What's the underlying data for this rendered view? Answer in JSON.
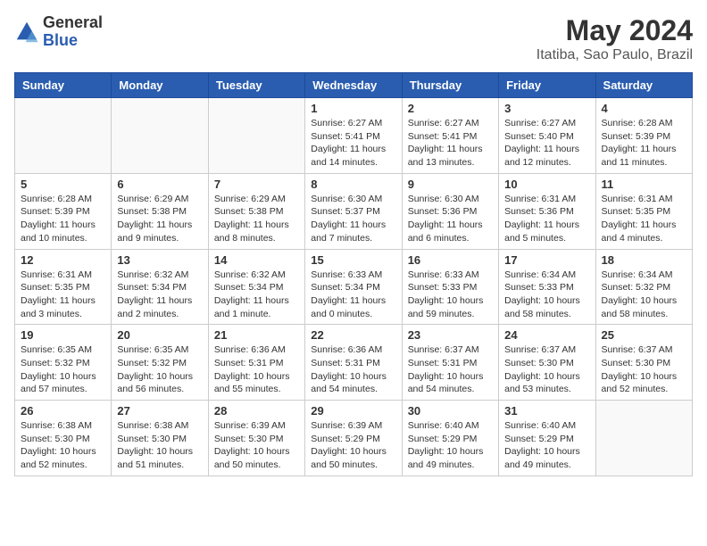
{
  "logo": {
    "general": "General",
    "blue": "Blue"
  },
  "title": "May 2024",
  "subtitle": "Itatiba, Sao Paulo, Brazil",
  "weekdays": [
    "Sunday",
    "Monday",
    "Tuesday",
    "Wednesday",
    "Thursday",
    "Friday",
    "Saturday"
  ],
  "weeks": [
    [
      {
        "day": "",
        "info": ""
      },
      {
        "day": "",
        "info": ""
      },
      {
        "day": "",
        "info": ""
      },
      {
        "day": "1",
        "info": "Sunrise: 6:27 AM\nSunset: 5:41 PM\nDaylight: 11 hours and 14 minutes."
      },
      {
        "day": "2",
        "info": "Sunrise: 6:27 AM\nSunset: 5:41 PM\nDaylight: 11 hours and 13 minutes."
      },
      {
        "day": "3",
        "info": "Sunrise: 6:27 AM\nSunset: 5:40 PM\nDaylight: 11 hours and 12 minutes."
      },
      {
        "day": "4",
        "info": "Sunrise: 6:28 AM\nSunset: 5:39 PM\nDaylight: 11 hours and 11 minutes."
      }
    ],
    [
      {
        "day": "5",
        "info": "Sunrise: 6:28 AM\nSunset: 5:39 PM\nDaylight: 11 hours and 10 minutes."
      },
      {
        "day": "6",
        "info": "Sunrise: 6:29 AM\nSunset: 5:38 PM\nDaylight: 11 hours and 9 minutes."
      },
      {
        "day": "7",
        "info": "Sunrise: 6:29 AM\nSunset: 5:38 PM\nDaylight: 11 hours and 8 minutes."
      },
      {
        "day": "8",
        "info": "Sunrise: 6:30 AM\nSunset: 5:37 PM\nDaylight: 11 hours and 7 minutes."
      },
      {
        "day": "9",
        "info": "Sunrise: 6:30 AM\nSunset: 5:36 PM\nDaylight: 11 hours and 6 minutes."
      },
      {
        "day": "10",
        "info": "Sunrise: 6:31 AM\nSunset: 5:36 PM\nDaylight: 11 hours and 5 minutes."
      },
      {
        "day": "11",
        "info": "Sunrise: 6:31 AM\nSunset: 5:35 PM\nDaylight: 11 hours and 4 minutes."
      }
    ],
    [
      {
        "day": "12",
        "info": "Sunrise: 6:31 AM\nSunset: 5:35 PM\nDaylight: 11 hours and 3 minutes."
      },
      {
        "day": "13",
        "info": "Sunrise: 6:32 AM\nSunset: 5:34 PM\nDaylight: 11 hours and 2 minutes."
      },
      {
        "day": "14",
        "info": "Sunrise: 6:32 AM\nSunset: 5:34 PM\nDaylight: 11 hours and 1 minute."
      },
      {
        "day": "15",
        "info": "Sunrise: 6:33 AM\nSunset: 5:34 PM\nDaylight: 11 hours and 0 minutes."
      },
      {
        "day": "16",
        "info": "Sunrise: 6:33 AM\nSunset: 5:33 PM\nDaylight: 10 hours and 59 minutes."
      },
      {
        "day": "17",
        "info": "Sunrise: 6:34 AM\nSunset: 5:33 PM\nDaylight: 10 hours and 58 minutes."
      },
      {
        "day": "18",
        "info": "Sunrise: 6:34 AM\nSunset: 5:32 PM\nDaylight: 10 hours and 58 minutes."
      }
    ],
    [
      {
        "day": "19",
        "info": "Sunrise: 6:35 AM\nSunset: 5:32 PM\nDaylight: 10 hours and 57 minutes."
      },
      {
        "day": "20",
        "info": "Sunrise: 6:35 AM\nSunset: 5:32 PM\nDaylight: 10 hours and 56 minutes."
      },
      {
        "day": "21",
        "info": "Sunrise: 6:36 AM\nSunset: 5:31 PM\nDaylight: 10 hours and 55 minutes."
      },
      {
        "day": "22",
        "info": "Sunrise: 6:36 AM\nSunset: 5:31 PM\nDaylight: 10 hours and 54 minutes."
      },
      {
        "day": "23",
        "info": "Sunrise: 6:37 AM\nSunset: 5:31 PM\nDaylight: 10 hours and 54 minutes."
      },
      {
        "day": "24",
        "info": "Sunrise: 6:37 AM\nSunset: 5:30 PM\nDaylight: 10 hours and 53 minutes."
      },
      {
        "day": "25",
        "info": "Sunrise: 6:37 AM\nSunset: 5:30 PM\nDaylight: 10 hours and 52 minutes."
      }
    ],
    [
      {
        "day": "26",
        "info": "Sunrise: 6:38 AM\nSunset: 5:30 PM\nDaylight: 10 hours and 52 minutes."
      },
      {
        "day": "27",
        "info": "Sunrise: 6:38 AM\nSunset: 5:30 PM\nDaylight: 10 hours and 51 minutes."
      },
      {
        "day": "28",
        "info": "Sunrise: 6:39 AM\nSunset: 5:30 PM\nDaylight: 10 hours and 50 minutes."
      },
      {
        "day": "29",
        "info": "Sunrise: 6:39 AM\nSunset: 5:29 PM\nDaylight: 10 hours and 50 minutes."
      },
      {
        "day": "30",
        "info": "Sunrise: 6:40 AM\nSunset: 5:29 PM\nDaylight: 10 hours and 49 minutes."
      },
      {
        "day": "31",
        "info": "Sunrise: 6:40 AM\nSunset: 5:29 PM\nDaylight: 10 hours and 49 minutes."
      },
      {
        "day": "",
        "info": ""
      }
    ]
  ]
}
